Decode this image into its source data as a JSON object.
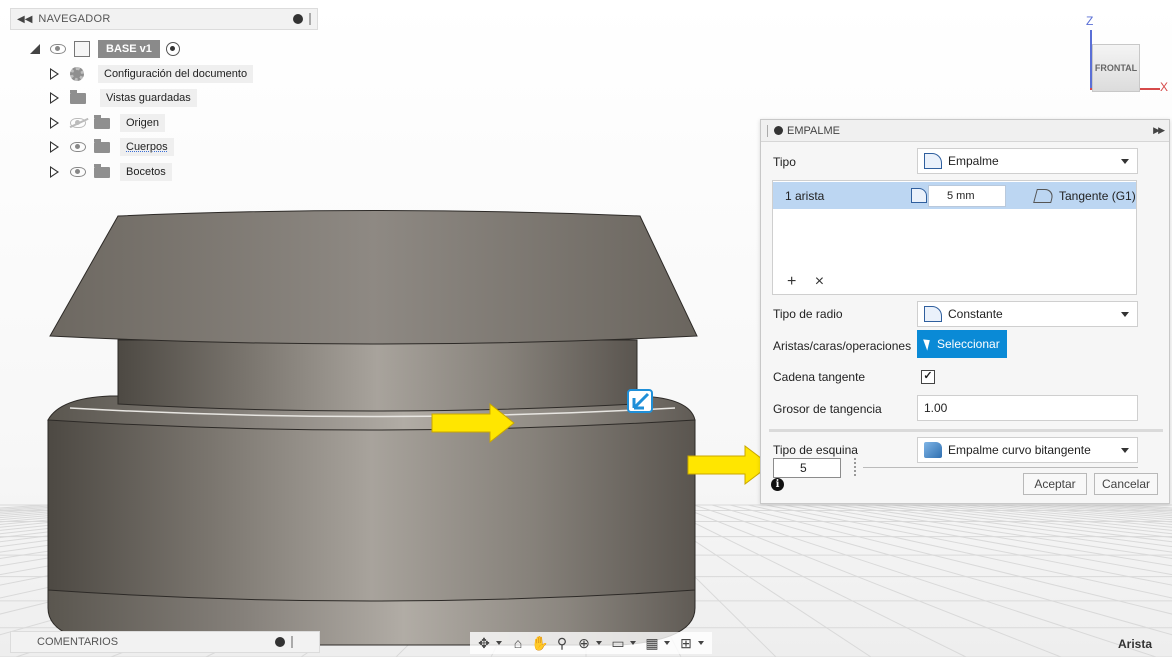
{
  "navigator": {
    "title": "NAVEGADOR",
    "root": {
      "name": "BASE v1"
    },
    "items": [
      {
        "label": "Configuración del documento",
        "icon": "gear-icon"
      },
      {
        "label": "Vistas guardadas",
        "icon": "folder-icon"
      },
      {
        "label": "Origen",
        "icon": "folder-icon"
      },
      {
        "label": "Cuerpos",
        "icon": "folder-icon"
      },
      {
        "label": "Bocetos",
        "icon": "folder-icon"
      }
    ]
  },
  "viewcube": {
    "z_axis": "Z",
    "x_axis": "X",
    "face": "FRONTAL",
    "z_color": "#5a6fd6",
    "x_color": "#d64a4a"
  },
  "dialog": {
    "title": "EMPALME",
    "type": {
      "label": "Tipo",
      "value": "Empalme"
    },
    "selection": {
      "edge": "1 arista",
      "radius": "5 mm",
      "continuity": "Tangente (G1)",
      "add": "+",
      "remove": "×"
    },
    "radius_type": {
      "label": "Tipo de radio",
      "value": "Constante"
    },
    "select": {
      "label": "Aristas/caras/operaciones",
      "button": "Seleccionar"
    },
    "tangent_chain": {
      "label": "Cadena tangente",
      "checked": "✓"
    },
    "tangency_weight": {
      "label": "Grosor de tangencia",
      "value": "1.00"
    },
    "corner_type": {
      "label": "Tipo de esquina",
      "value": "Empalme curvo bitangente"
    },
    "floating_input": "5",
    "info": "i",
    "ok": "Aceptar",
    "cancel": "Cancelar",
    "accent": "#0a8ad6",
    "selected_row": "#bcd6f2"
  },
  "bottom": {
    "comments": "COMENTARIOS",
    "status": "Arista"
  },
  "colors": {
    "model": "#7a756e",
    "arrow": "#ffe600",
    "marker": "#1f8fd8"
  }
}
